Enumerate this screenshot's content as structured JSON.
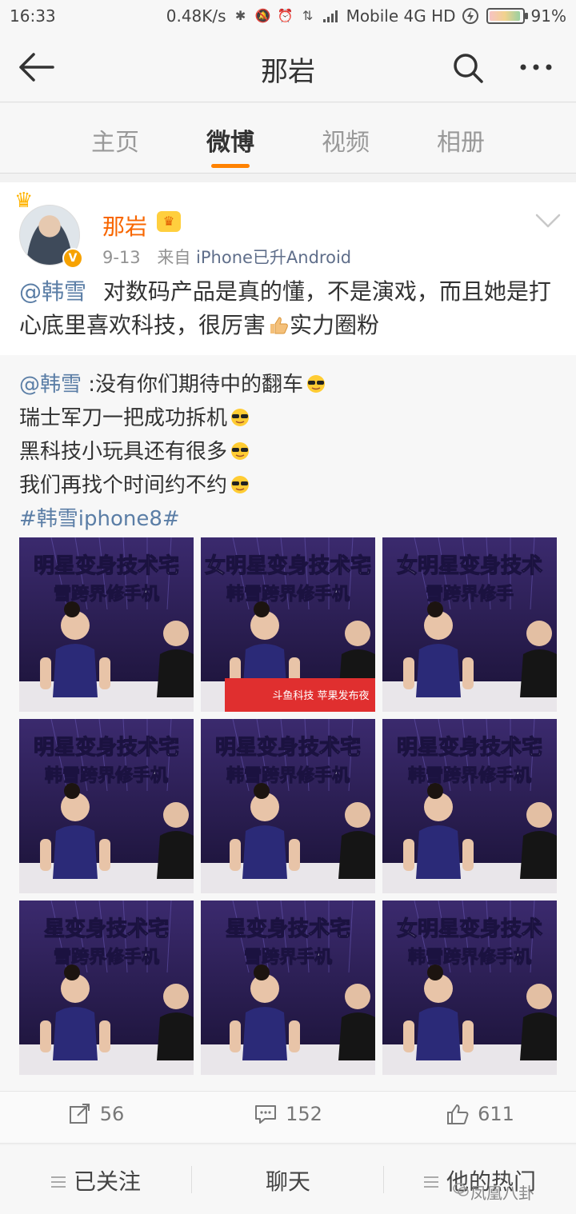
{
  "status_bar": {
    "time": "16:33",
    "speed": "0.48K/s",
    "network": "Mobile 4G HD",
    "battery": "91%",
    "icons": [
      "bluetooth-icon",
      "mute-icon",
      "alarm-icon",
      "data-arrows-icon",
      "signal-icon",
      "charging-icon",
      "battery-icon"
    ]
  },
  "nav": {
    "title": "那岩",
    "icons": [
      "back-arrow-icon",
      "search-icon",
      "more-icon"
    ]
  },
  "tabs": [
    {
      "label": "主页",
      "active": false
    },
    {
      "label": "微博",
      "active": true
    },
    {
      "label": "视频",
      "active": false
    },
    {
      "label": "相册",
      "active": false
    }
  ],
  "post": {
    "author": "那岩",
    "date": "9-13",
    "source_prefix": "来自",
    "source": "iPhone已升Android",
    "mention": "@韩雪",
    "text_1": "对数码产品是真的懂，不是演戏，而且她是打心底里喜欢科技，很厉害",
    "text_2": "实力圈粉",
    "repost": {
      "mention": "@韩雪",
      "line_1": ":没有你们期待中的翻车",
      "line_2": "瑞士军刀一把成功拆机",
      "line_3": "黑科技小玩具还有很多",
      "line_4": "我们再找个时间约不约",
      "hashtag": "#韩雪iphone8#"
    }
  },
  "photos": [
    {
      "banner": "明星变身技术宅",
      "sub": "雪跨界修手机"
    },
    {
      "banner": "女明星变身技术宅",
      "sub": "韩雪跨界修手机",
      "desk": "斗鱼科技 苹果发布夜"
    },
    {
      "banner": "女明星变身技术",
      "sub": "雪跨界修手"
    },
    {
      "banner": "明星变身技术宅",
      "sub": "韩雪跨界修手机"
    },
    {
      "banner": "明星变身技术宅",
      "sub": "韩雪跨界修手机"
    },
    {
      "banner": "明星变身技术宅",
      "sub": "韩雪跨界修手机"
    },
    {
      "banner": "星变身技术宅",
      "sub": "雪跨界修手机"
    },
    {
      "banner": "星变身技术宅",
      "sub": "雪跨界手机"
    },
    {
      "banner": "女明星变身技术",
      "sub": "韩雪跨界修手机"
    }
  ],
  "actions": {
    "repost_count": "56",
    "comment_count": "152",
    "like_count": "611"
  },
  "bottom_bar": {
    "follow": "已关注",
    "chat": "聊天",
    "hot": "他的热门"
  },
  "watermark": "凤凰八卦",
  "colors": {
    "accent_orange": "#ff8200",
    "name_orange": "#f86600",
    "link_blue": "#5b7ea6"
  }
}
